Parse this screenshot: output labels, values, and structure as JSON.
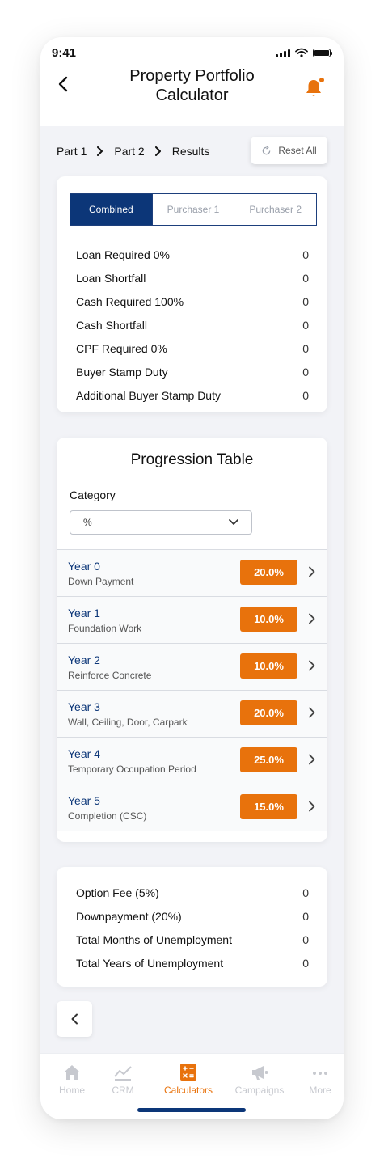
{
  "status": {
    "time": "9:41"
  },
  "header": {
    "title_line1": "Property Portfolio",
    "title_line2": "Calculator"
  },
  "breadcrumb": {
    "part1": "Part 1",
    "part2": "Part 2",
    "results": "Results"
  },
  "reset_label": "Reset All",
  "tabs": [
    {
      "label": "Combined",
      "active": true
    },
    {
      "label": "Purchaser 1",
      "active": false
    },
    {
      "label": "Purchaser 2",
      "active": false
    }
  ],
  "summary": [
    {
      "label": "Loan Required 0%",
      "value": "0"
    },
    {
      "label": "Loan Shortfall",
      "value": "0"
    },
    {
      "label": "Cash Required 100%",
      "value": "0"
    },
    {
      "label": "Cash Shortfall",
      "value": "0"
    },
    {
      "label": "CPF Required 0%",
      "value": "0"
    },
    {
      "label": "Buyer Stamp Duty",
      "value": "0"
    },
    {
      "label": "Additional Buyer Stamp Duty",
      "value": "0"
    }
  ],
  "progression": {
    "title": "Progression Table",
    "category_label": "Category",
    "category_value": "%",
    "years": [
      {
        "name": "Year 0",
        "desc": "Down Payment",
        "pct": "20.0%"
      },
      {
        "name": "Year 1",
        "desc": "Foundation Work",
        "pct": "10.0%"
      },
      {
        "name": "Year 2",
        "desc": "Reinforce Concrete",
        "pct": "10.0%"
      },
      {
        "name": "Year 3",
        "desc": "Wall, Ceiling, Door, Carpark",
        "pct": "20.0%"
      },
      {
        "name": "Year 4",
        "desc": "Temporary Occupation Period",
        "pct": "25.0%"
      },
      {
        "name": "Year 5",
        "desc": "Completion (CSC)",
        "pct": "15.0%"
      }
    ]
  },
  "summary2": [
    {
      "label": "Option Fee (5%)",
      "value": "0"
    },
    {
      "label": "Downpayment (20%)",
      "value": "0"
    },
    {
      "label": "Total Months of Unemployment",
      "value": "0"
    },
    {
      "label": "Total Years of Unemployment",
      "value": "0"
    }
  ],
  "tabbar": [
    {
      "label": "Home",
      "icon": "home-icon"
    },
    {
      "label": "CRM",
      "icon": "chart-icon"
    },
    {
      "label": "Calculators",
      "icon": "calculator-icon",
      "active": true
    },
    {
      "label": "Campaigns",
      "icon": "megaphone-icon"
    },
    {
      "label": "More",
      "icon": "more-icon"
    }
  ],
  "colors": {
    "accent": "#e8720c",
    "navy": "#0c3678",
    "background": "#f2f3f7"
  }
}
